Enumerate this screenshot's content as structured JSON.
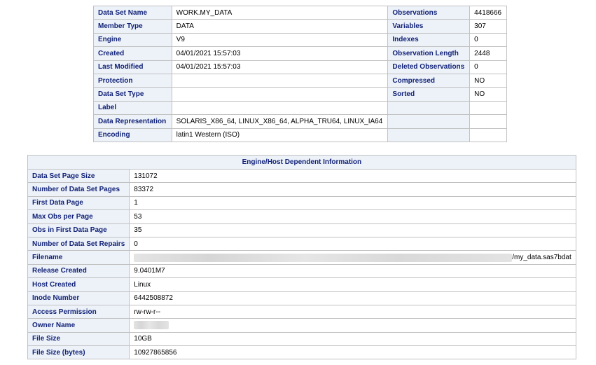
{
  "dataset_attributes": [
    {
      "label1": "Data Set Name",
      "value1": "WORK.MY_DATA",
      "label2": "Observations",
      "value2": "4418666"
    },
    {
      "label1": "Member Type",
      "value1": "DATA",
      "label2": "Variables",
      "value2": "307"
    },
    {
      "label1": "Engine",
      "value1": "V9",
      "label2": "Indexes",
      "value2": "0"
    },
    {
      "label1": "Created",
      "value1": "04/01/2021 15:57:03",
      "label2": "Observation Length",
      "value2": "2448"
    },
    {
      "label1": "Last Modified",
      "value1": "04/01/2021 15:57:03",
      "label2": "Deleted Observations",
      "value2": "0"
    },
    {
      "label1": "Protection",
      "value1": "",
      "label2": "Compressed",
      "value2": "NO"
    },
    {
      "label1": "Data Set Type",
      "value1": "",
      "label2": "Sorted",
      "value2": "NO"
    },
    {
      "label1": "Label",
      "value1": "",
      "label2": "",
      "value2": ""
    },
    {
      "label1": "Data Representation",
      "value1": "SOLARIS_X86_64, LINUX_X86_64, ALPHA_TRU64, LINUX_IA64",
      "label2": "",
      "value2": ""
    },
    {
      "label1": "Encoding",
      "value1": "latin1 Western (ISO)",
      "label2": "",
      "value2": ""
    }
  ],
  "engine_info": {
    "title": "Engine/Host Dependent Information",
    "rows": [
      {
        "label": "Data Set Page Size",
        "value": "131072"
      },
      {
        "label": "Number of Data Set Pages",
        "value": "83372"
      },
      {
        "label": "First Data Page",
        "value": "1"
      },
      {
        "label": "Max Obs per Page",
        "value": "53"
      },
      {
        "label": "Obs in First Data Page",
        "value": "35"
      },
      {
        "label": "Number of Data Set Repairs",
        "value": "0"
      },
      {
        "label": "Filename",
        "value": "/my_data.sas7bdat"
      },
      {
        "label": "Release Created",
        "value": "9.0401M7"
      },
      {
        "label": "Host Created",
        "value": "Linux"
      },
      {
        "label": "Inode Number",
        "value": "6442508872"
      },
      {
        "label": "Access Permission",
        "value": "rw-rw-r--"
      },
      {
        "label": "Owner Name",
        "value": ""
      },
      {
        "label": "File Size",
        "value": "10GB"
      },
      {
        "label": "File Size (bytes)",
        "value": "10927865856"
      }
    ]
  }
}
